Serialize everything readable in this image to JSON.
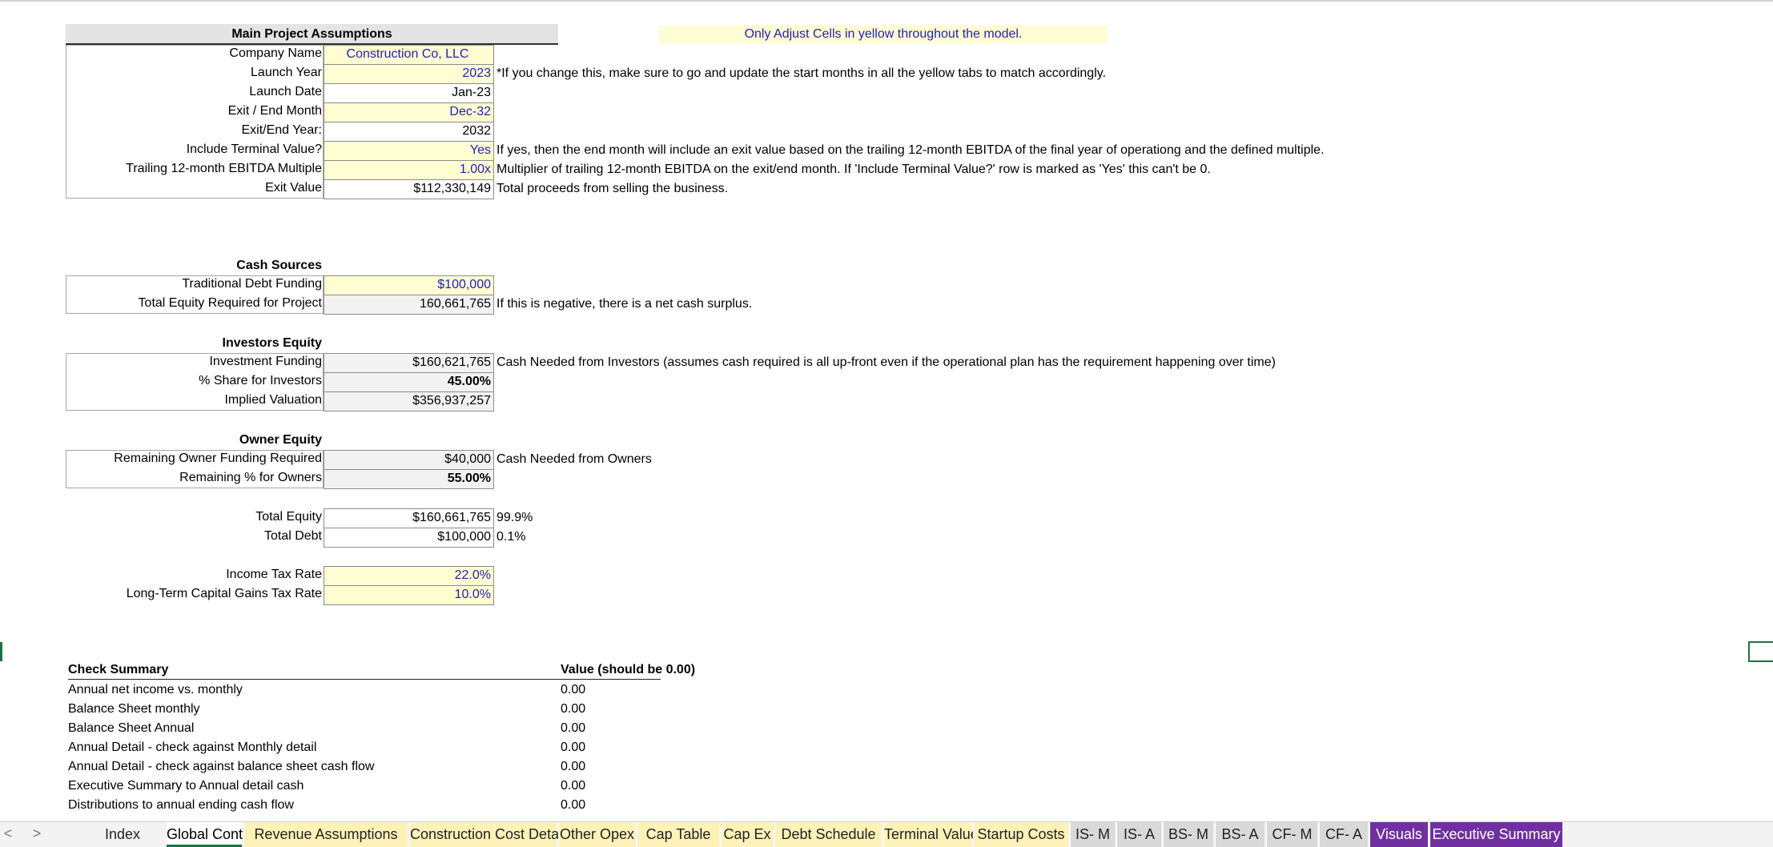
{
  "main": {
    "header": "Main Project Assumptions",
    "notice": "Only Adjust Cells in yellow throughout the model.",
    "rows": [
      {
        "label": "Company Name",
        "value": "Construction Co, LLC",
        "note": ""
      },
      {
        "label": "Launch Year",
        "value": "2023",
        "note": "*If you change this, make sure to go and update the start months in all the yellow tabs to match accordingly."
      },
      {
        "label": "Launch Date",
        "value": "Jan-23",
        "note": ""
      },
      {
        "label": "Exit / End Month",
        "value": "Dec-32",
        "note": ""
      },
      {
        "label": "Exit/End Year:",
        "value": "2032",
        "note": ""
      },
      {
        "label": "Include Terminal Value?",
        "value": "Yes",
        "note": "If yes, then the end month will include an exit value based on the trailing 12-month EBITDA of the final year of operationg and the defined multiple."
      },
      {
        "label": "Trailing 12-month EBITDA Multiple",
        "value": "1.00x",
        "note": "Multiplier of trailing 12-month EBITDA on the exit/end month. If 'Include Terminal Value?' row is marked as 'Yes' this can't be 0."
      },
      {
        "label": "Exit Value",
        "value": "$112,330,149",
        "note": "Total proceeds from selling the business."
      }
    ]
  },
  "cash_sources": {
    "header": "Cash Sources",
    "rows": [
      {
        "label": "Traditional Debt Funding",
        "value": "$100,000",
        "note": ""
      },
      {
        "label": "Total Equity Required for Project",
        "value": "160,661,765",
        "note": "If this is negative, there is a net cash surplus."
      }
    ]
  },
  "investors_equity": {
    "header": "Investors Equity",
    "rows": [
      {
        "label": "Investment Funding",
        "value": "$160,621,765",
        "note": "Cash Needed from Investors (assumes cash required is all up-front even if the operational plan has the requirement happening over time)"
      },
      {
        "label": "% Share for Investors",
        "value": "45.00%",
        "note": ""
      },
      {
        "label": "Implied Valuation",
        "value": "$356,937,257",
        "note": ""
      }
    ]
  },
  "owner_equity": {
    "header": "Owner Equity",
    "rows": [
      {
        "label": "Remaining Owner Funding Required",
        "value": "$40,000",
        "note": "Cash Needed from Owners"
      },
      {
        "label": "Remaining % for Owners",
        "value": "55.00%",
        "note": ""
      }
    ]
  },
  "totals": {
    "rows": [
      {
        "label": "Total Equity",
        "value": "$160,661,765",
        "pct": "99.9%"
      },
      {
        "label": "Total Debt",
        "value": "$100,000",
        "pct": "0.1%"
      }
    ]
  },
  "taxes": {
    "rows": [
      {
        "label": "Income Tax Rate",
        "value": "22.0%"
      },
      {
        "label": "Long-Term Capital Gains Tax Rate",
        "value": "10.0%"
      }
    ]
  },
  "checks": {
    "header": "Check Summary",
    "value_header": "Value (should be 0.00)",
    "rows": [
      {
        "label": "Annual net income vs. monthly",
        "value": "0.00"
      },
      {
        "label": "Balance Sheet monthly",
        "value": "0.00"
      },
      {
        "label": "Balance Sheet Annual",
        "value": "0.00"
      },
      {
        "label": "Annual Detail - check against Monthly detail",
        "value": "0.00"
      },
      {
        "label": "Annual Detail - check against balance sheet cash flow",
        "value": "0.00"
      },
      {
        "label": "Executive Summary to Annual detail cash",
        "value": "0.00"
      },
      {
        "label": "Distributions to annual ending cash flow",
        "value": "0.00"
      }
    ]
  },
  "tabs": {
    "nav_prev": "<",
    "nav_next": ">",
    "items": [
      {
        "label": "Index",
        "style": "plain"
      },
      {
        "label": "Global Control",
        "style": "active"
      },
      {
        "label": "Revenue Assumptions",
        "style": "yellow"
      },
      {
        "label": "Construction Cost Detail",
        "style": "yellow"
      },
      {
        "label": "Other Opex",
        "style": "yellow"
      },
      {
        "label": "Cap Table",
        "style": "yellow"
      },
      {
        "label": "Cap Ex",
        "style": "yellow"
      },
      {
        "label": "Debt Schedule",
        "style": "yellow"
      },
      {
        "label": "Terminal Value",
        "style": "yellow"
      },
      {
        "label": "Startup Costs",
        "style": "yellow"
      },
      {
        "label": "IS- M",
        "style": "gray"
      },
      {
        "label": "IS- A",
        "style": "gray"
      },
      {
        "label": "BS- M",
        "style": "gray"
      },
      {
        "label": "BS- A",
        "style": "gray"
      },
      {
        "label": "CF- M",
        "style": "gray"
      },
      {
        "label": "CF- A",
        "style": "gray"
      },
      {
        "label": "Visuals",
        "style": "purple"
      },
      {
        "label": "Executive Summary",
        "style": "purple"
      }
    ]
  },
  "colors": {
    "input_yellow": "#fffdd2",
    "input_blue": "#1f1fb8",
    "purple_tab": "#7030a0",
    "active_tab_underline": "#1e7145"
  }
}
